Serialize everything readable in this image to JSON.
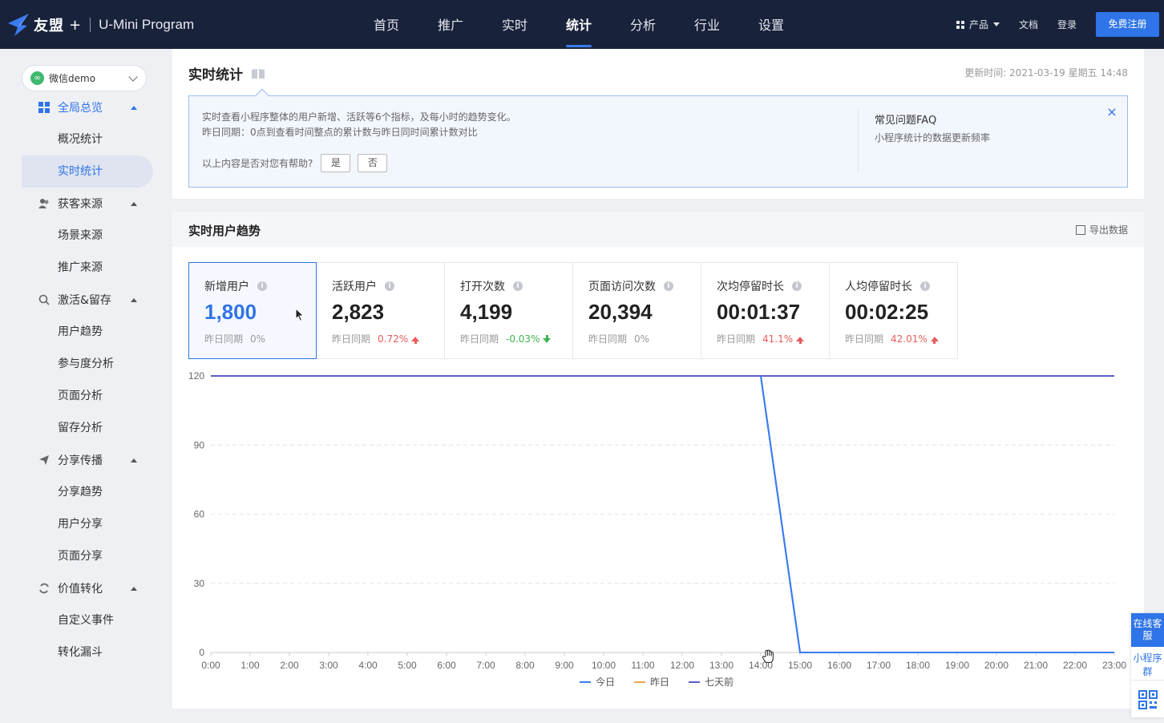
{
  "topbar": {
    "logo_text": "友盟",
    "logo_plus": "+",
    "logo_sub": "U-Mini Program",
    "nav": [
      "首页",
      "推广",
      "实时",
      "统计",
      "分析",
      "行业",
      "设置"
    ],
    "nav_active": "统计",
    "product_label": "产品",
    "docs_label": "文档",
    "login_label": "登录",
    "signup_label": "免费注册"
  },
  "sidebar": {
    "app_name": "微信demo",
    "groups": [
      {
        "label": "全局总览",
        "active": true,
        "items": [
          "概况统计",
          "实时统计"
        ]
      },
      {
        "label": "获客来源",
        "items": [
          "场景来源",
          "推广来源"
        ]
      },
      {
        "label": "激活&留存",
        "items": [
          "用户趋势",
          "参与度分析",
          "页面分析",
          "留存分析"
        ]
      },
      {
        "label": "分享传播",
        "items": [
          "分享趋势",
          "用户分享",
          "页面分享"
        ]
      },
      {
        "label": "价值转化",
        "items": [
          "自定义事件",
          "转化漏斗"
        ]
      }
    ],
    "active_item": "实时统计"
  },
  "header": {
    "title": "实时统计",
    "update_time": "更新时间: 2021-03-19 星期五 14:48"
  },
  "info": {
    "line1": "实时查看小程序整体的用户新增、活跃等6个指标，及每小时的趋势变化。",
    "line2": "昨日同期：0点到查看时间整点的累计数与昨日同时间累计数对比",
    "helpful_q": "以上内容是否对您有帮助?",
    "yes": "是",
    "no": "否",
    "faq_title": "常见问题FAQ",
    "faq_link": "小程序统计的数据更新频率",
    "close": "×"
  },
  "trend": {
    "title": "实时用户趋势",
    "export_label": "导出数据"
  },
  "metrics": [
    {
      "label": "新增用户",
      "value": "1,800",
      "comp_label": "昨日同期",
      "pct": "0%",
      "dir": "flat",
      "active": true
    },
    {
      "label": "活跃用户",
      "value": "2,823",
      "comp_label": "昨日同期",
      "pct": "0.72%",
      "dir": "up"
    },
    {
      "label": "打开次数",
      "value": "4,199",
      "comp_label": "昨日同期",
      "pct": "-0.03%",
      "dir": "down"
    },
    {
      "label": "页面访问次数",
      "value": "20,394",
      "comp_label": "昨日同期",
      "pct": "0%",
      "dir": "flat"
    },
    {
      "label": "次均停留时长",
      "value": "00:01:37",
      "comp_label": "昨日同期",
      "pct": "41.1%",
      "dir": "up"
    },
    {
      "label": "人均停留时长",
      "value": "00:02:25",
      "comp_label": "昨日同期",
      "pct": "42.01%",
      "dir": "up"
    }
  ],
  "float": {
    "service": "在线客服",
    "group": "小程序群"
  },
  "colors": {
    "today": "#3a7cf0",
    "yesterday": "#f0a04b",
    "sevendays": "#5b5fc7"
  },
  "chart_data": {
    "type": "line",
    "x": [
      "0:00",
      "1:00",
      "2:00",
      "3:00",
      "4:00",
      "5:00",
      "6:00",
      "7:00",
      "8:00",
      "9:00",
      "10:00",
      "11:00",
      "12:00",
      "13:00",
      "14:00",
      "15:00",
      "16:00",
      "17:00",
      "18:00",
      "19:00",
      "20:00",
      "21:00",
      "22:00",
      "23:00"
    ],
    "yticks": [
      0,
      30,
      60,
      90,
      120
    ],
    "ylim": [
      0,
      120
    ],
    "series": [
      {
        "name": "今日",
        "color": "#3a7cf0",
        "values": [
          120,
          120,
          120,
          120,
          120,
          120,
          120,
          120,
          120,
          120,
          120,
          120,
          120,
          120,
          120,
          0,
          0,
          0,
          0,
          0,
          0,
          0,
          0,
          0
        ]
      },
      {
        "name": "昨日",
        "color": "#f0a04b",
        "values": [
          120,
          120,
          120,
          120,
          120,
          120,
          120,
          120,
          120,
          120,
          120,
          120,
          120,
          120,
          120,
          120,
          120,
          120,
          120,
          120,
          120,
          120,
          120,
          120
        ]
      },
      {
        "name": "七天前",
        "color": "#5b5fc7",
        "values": [
          120,
          120,
          120,
          120,
          120,
          120,
          120,
          120,
          120,
          120,
          120,
          120,
          120,
          120,
          120,
          120,
          120,
          120,
          120,
          120,
          120,
          120,
          120,
          120
        ]
      }
    ],
    "legend_position": "bottom",
    "grid": true
  }
}
